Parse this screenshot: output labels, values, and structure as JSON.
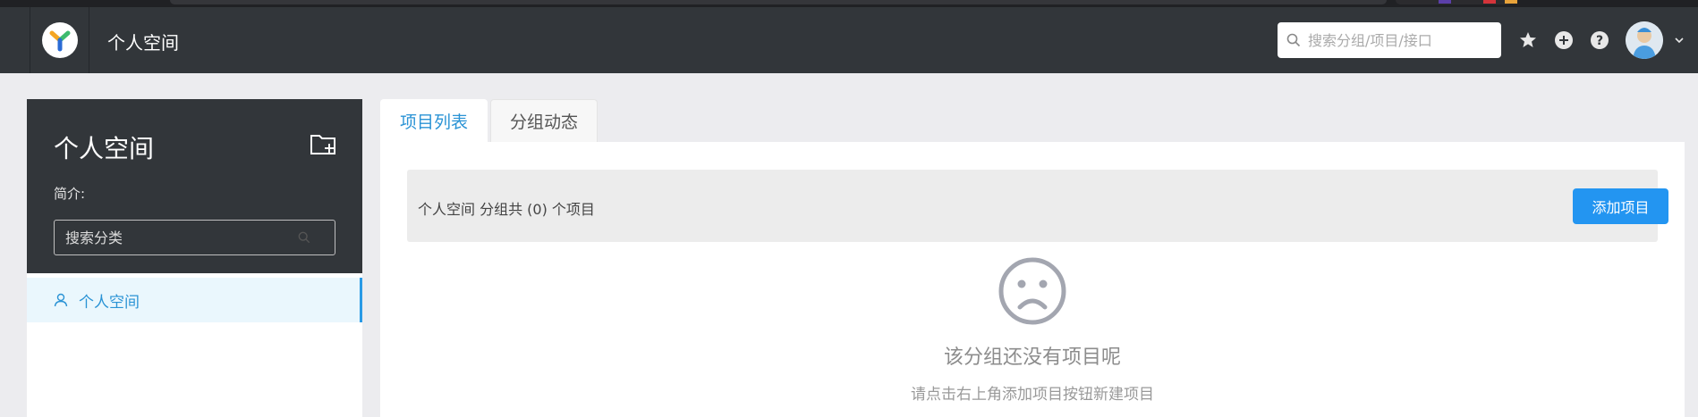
{
  "header": {
    "title": "个人空间",
    "search_placeholder": "搜索分组/项目/接口",
    "icons": [
      "star-icon",
      "plus-circle-icon",
      "question-icon"
    ]
  },
  "sidebar": {
    "title": "个人空间",
    "intro_label": "简介:",
    "category_search_placeholder": "搜索分类",
    "items": [
      {
        "label": "个人空间",
        "icon": "user-icon",
        "active": true
      }
    ]
  },
  "tabs": [
    {
      "label": "项目列表",
      "active": true
    },
    {
      "label": "分组动态",
      "active": false
    }
  ],
  "main": {
    "info_text": "个人空间 分组共 (0) 个项目",
    "add_button": "添加项目",
    "empty_title": "该分组还没有项目呢",
    "empty_subtitle": "请点击右上角添加项目按钮新建项目"
  },
  "colors": {
    "header_bg": "#32363a",
    "accent": "#2395f1",
    "link_blue": "#2a93d5"
  }
}
